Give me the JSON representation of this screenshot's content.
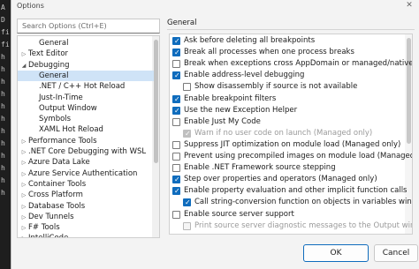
{
  "window": {
    "title": "Options"
  },
  "search": {
    "placeholder": "Search Options (Ctrl+E)"
  },
  "tree": [
    {
      "label": "General",
      "level": 2,
      "chevron": ""
    },
    {
      "label": "Text Editor",
      "level": 1,
      "chevron": "▷"
    },
    {
      "label": "Debugging",
      "level": 1,
      "chevron": "◢"
    },
    {
      "label": "General",
      "level": 2,
      "chevron": "",
      "selected": true
    },
    {
      "label": ".NET / C++ Hot Reload",
      "level": 2,
      "chevron": ""
    },
    {
      "label": "Just-In-Time",
      "level": 2,
      "chevron": ""
    },
    {
      "label": "Output Window",
      "level": 2,
      "chevron": ""
    },
    {
      "label": "Symbols",
      "level": 2,
      "chevron": ""
    },
    {
      "label": "XAML Hot Reload",
      "level": 2,
      "chevron": ""
    },
    {
      "label": "Performance Tools",
      "level": 1,
      "chevron": "▷"
    },
    {
      "label": ".NET Core Debugging with WSL",
      "level": 1,
      "chevron": "▷"
    },
    {
      "label": "Azure Data Lake",
      "level": 1,
      "chevron": "▷"
    },
    {
      "label": "Azure Service Authentication",
      "level": 1,
      "chevron": "▷"
    },
    {
      "label": "Container Tools",
      "level": 1,
      "chevron": "▷"
    },
    {
      "label": "Cross Platform",
      "level": 1,
      "chevron": "▷"
    },
    {
      "label": "Database Tools",
      "level": 1,
      "chevron": "▷"
    },
    {
      "label": "Dev Tunnels",
      "level": 1,
      "chevron": "▷"
    },
    {
      "label": "F# Tools",
      "level": 1,
      "chevron": "▷"
    },
    {
      "label": "IntelliCode",
      "level": 1,
      "chevron": "▷"
    }
  ],
  "section": {
    "title": "General"
  },
  "options": [
    {
      "label": "Ask before deleting all breakpoints",
      "checked": true,
      "indent": 0,
      "disabled": false
    },
    {
      "label": "Break all processes when one process breaks",
      "checked": true,
      "indent": 0,
      "disabled": false
    },
    {
      "label": "Break when exceptions cross AppDomain or managed/native bounda",
      "checked": false,
      "indent": 0,
      "disabled": false
    },
    {
      "label": "Enable address-level debugging",
      "checked": true,
      "indent": 0,
      "disabled": false
    },
    {
      "label": "Show disassembly if source is not available",
      "checked": false,
      "indent": 1,
      "disabled": false
    },
    {
      "label": "Enable breakpoint filters",
      "checked": true,
      "indent": 0,
      "disabled": false
    },
    {
      "label": "Use the new Exception Helper",
      "checked": true,
      "indent": 0,
      "disabled": false
    },
    {
      "label": "Enable Just My Code",
      "checked": false,
      "indent": 0,
      "disabled": false
    },
    {
      "label": "Warn if no user code on launch (Managed only)",
      "checked": true,
      "indent": 1,
      "disabled": true
    },
    {
      "label": "Suppress JIT optimization on module load (Managed only)",
      "checked": false,
      "indent": 0,
      "disabled": false
    },
    {
      "label": "Prevent using precompiled images on module load (Managed only)",
      "checked": false,
      "indent": 0,
      "disabled": false
    },
    {
      "label": "Enable .NET Framework source stepping",
      "checked": false,
      "indent": 0,
      "disabled": false
    },
    {
      "label": "Step over properties and operators (Managed only)",
      "checked": true,
      "indent": 0,
      "disabled": false
    },
    {
      "label": "Enable property evaluation and other implicit function calls",
      "checked": true,
      "indent": 0,
      "disabled": false
    },
    {
      "label": "Call string-conversion function on objects in variables window",
      "checked": true,
      "indent": 1,
      "disabled": false
    },
    {
      "label": "Enable source server support",
      "checked": false,
      "indent": 0,
      "disabled": false
    },
    {
      "label": "Print source server diagnostic messages to the Output window",
      "checked": false,
      "indent": 1,
      "disabled": true
    }
  ],
  "buttons": {
    "ok": "OK",
    "cancel": "Cancel"
  },
  "bg_code": [
    "A",
    "D",
    "fi",
    "fi",
    "h",
    "h",
    "h",
    "h",
    "h",
    "h",
    "h",
    "h",
    "h",
    "h",
    "h",
    "h"
  ]
}
